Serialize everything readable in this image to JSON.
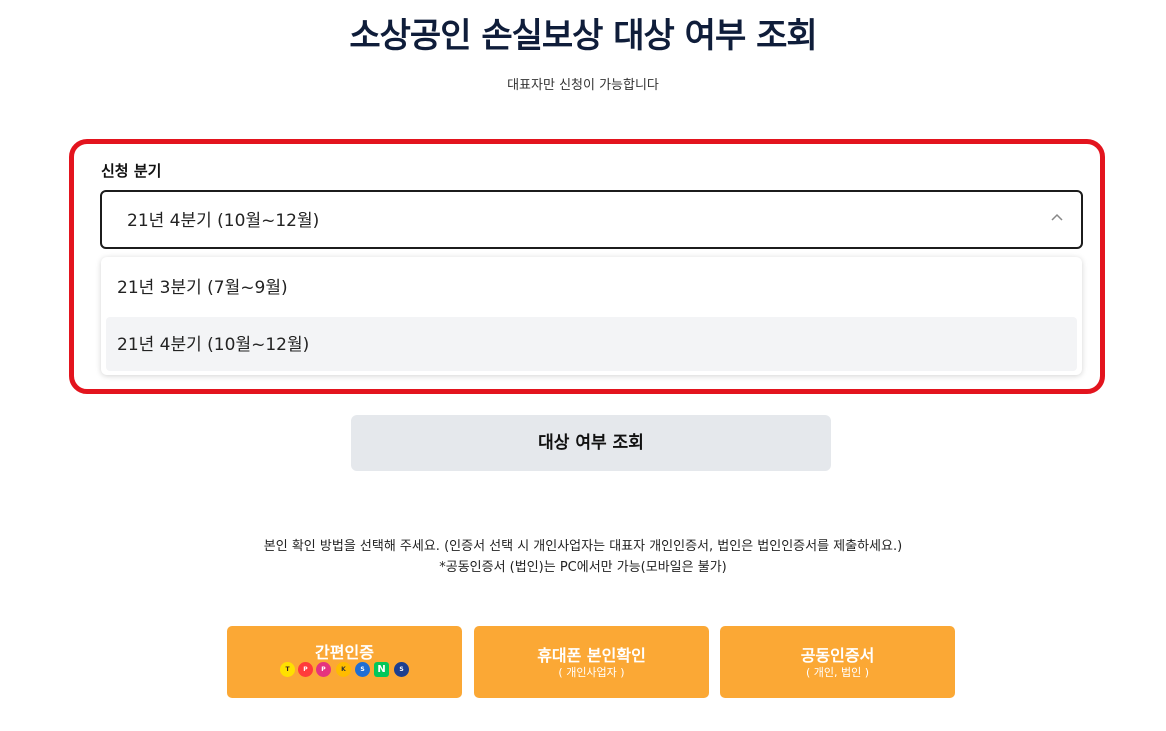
{
  "page": {
    "title": "소상공인 손실보상 대상 여부 조회",
    "subtitle": "대표자만 신청이 가능합니다"
  },
  "quarter_select": {
    "label": "신청 분기",
    "selected": "21년 4분기 (10월~12월)",
    "options": [
      {
        "label": "21년 3분기 (7월~9월)"
      },
      {
        "label": "21년 4분기 (10월~12월)"
      }
    ]
  },
  "search_button": {
    "label": "대상 여부 조회"
  },
  "notice": {
    "line1": "본인 확인 방법을 선택해 주세요. (인증서 선택 시 개인사업자는 대표자 개인인증서, 법인은 법인인증서를 제출하세요.)",
    "line2": "*공동인증서 (법인)는 PC에서만 가능(모바일은 불가)"
  },
  "auth_buttons": [
    {
      "label": "간편인증",
      "sub": ""
    },
    {
      "label": "휴대폰 본인확인",
      "sub": "( 개인사업자 )"
    },
    {
      "label": "공동인증서",
      "sub": "( 개인, 법인 )"
    }
  ],
  "auth_provider_icons": [
    {
      "name": "kakao-icon",
      "color": "#ffe000"
    },
    {
      "name": "payco-icon",
      "color": "#ff3b3b"
    },
    {
      "name": "pass-icon",
      "color": "#e5337e"
    },
    {
      "name": "kb-icon",
      "color": "#ffbc00"
    },
    {
      "name": "samsung-pass-icon",
      "color": "#1f6ed4"
    },
    {
      "name": "naver-icon",
      "color": "#03c75a"
    },
    {
      "name": "shinhan-icon",
      "color": "#1d3f8f"
    }
  ],
  "colors": {
    "highlight_border": "#e3141e",
    "auth_button": "#fba835",
    "title": "#0f1d3a",
    "search_button_bg": "#e5e8ec"
  }
}
